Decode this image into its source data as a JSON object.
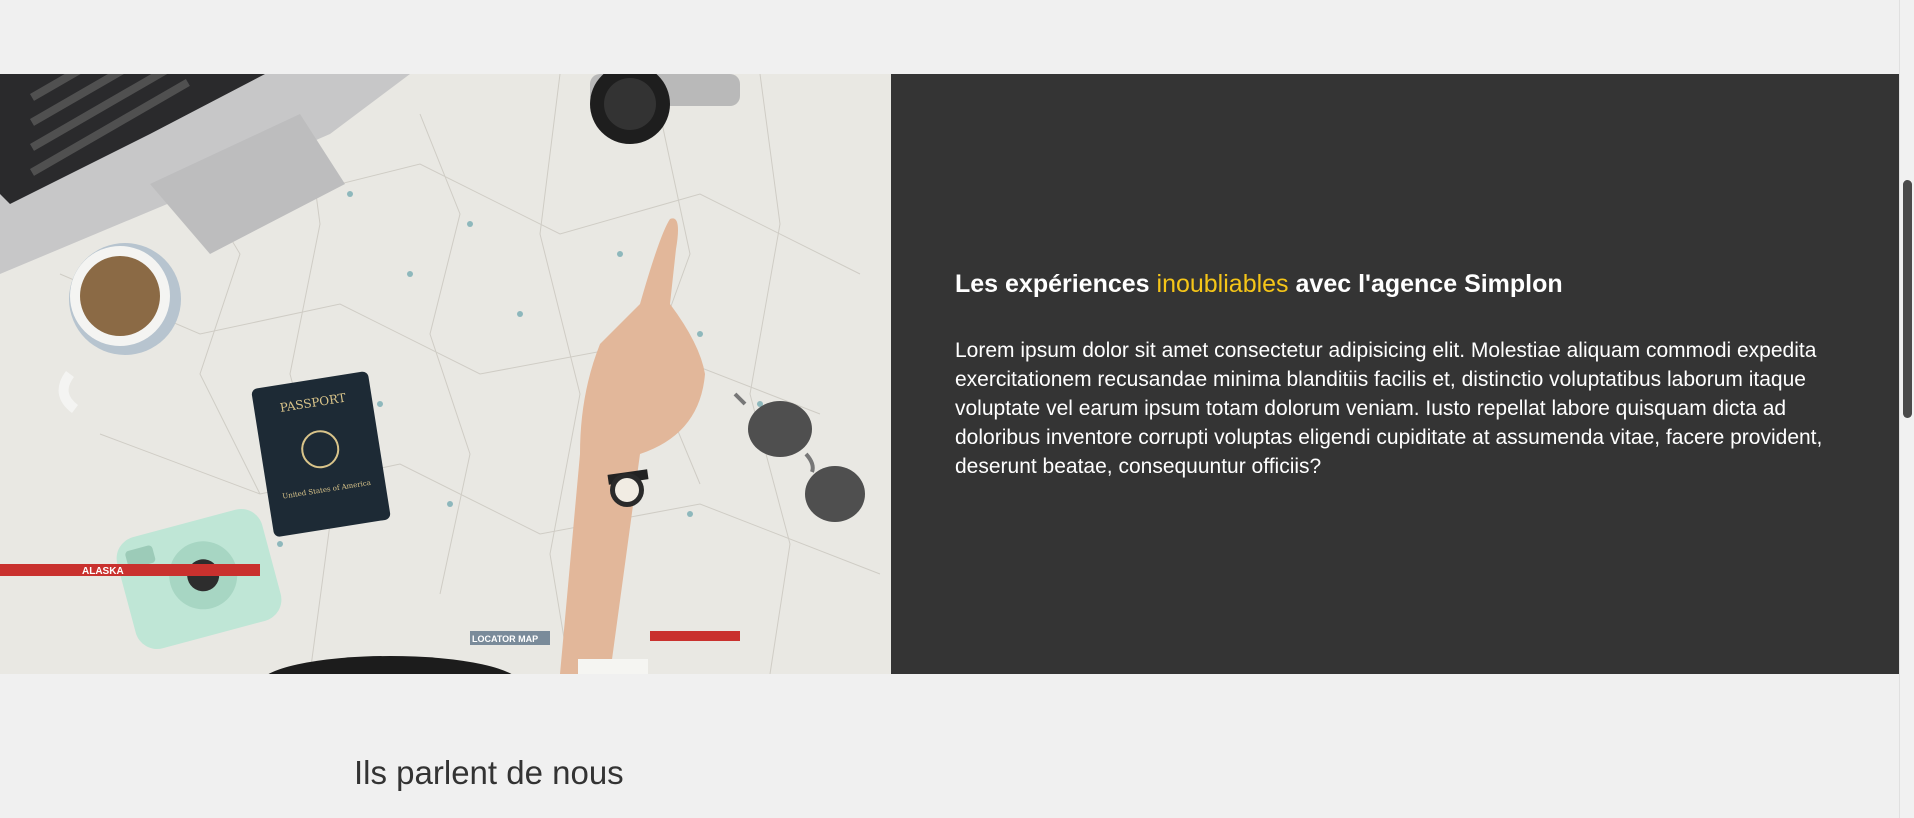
{
  "feature": {
    "image_alt": "Travel map with passport, camera, laptop, coffee and sunglasses",
    "image_labels": {
      "passport": "PASSPORT",
      "passport_sub": "United States of America",
      "alaska": "ALASKA",
      "locator_map": "LOCATOR MAP"
    },
    "title_before": "Les expériences ",
    "title_accent": "inoubliables",
    "title_after": " avec l'agence Simplon",
    "body": "Lorem ipsum dolor sit amet consectetur adipisicing elit. Molestiae aliquam commodi expedita exercitationem recusandae minima blanditiis facilis et, distinctio voluptatibus laborum itaque voluptate vel earum ipsum totam dolorum veniam. Iusto repellat labore quisquam dicta ad doloribus inventore corrupti voluptas eligendi cupiditate at assumenda vitae, facere provident, deserunt beatae, consequuntur officiis?"
  },
  "testimonials": {
    "heading": "Ils parlent de nous"
  },
  "colors": {
    "accent": "#f5c518",
    "panel": "#343434",
    "background": "#f0f0f0"
  }
}
